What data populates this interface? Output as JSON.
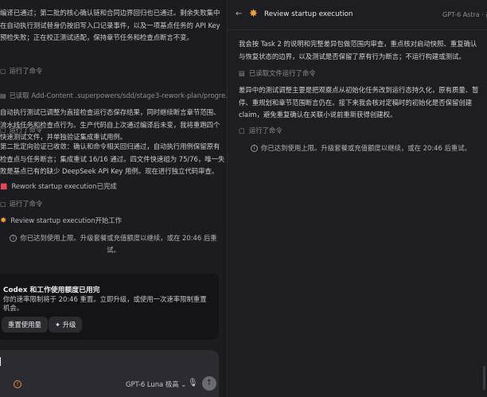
{
  "left": {
    "lines": [
      "编译已通过；第二批的核心确认链和合同边界回归也已通过。剩余失败集中",
      "在自动执行测试替身仍按旧写入口记录事件，以及一项基点任务的 API Key",
      "预检失败；正在校正测试适配，保持章节任务和检查点断言不变。"
    ],
    "meta1": "运行了命令",
    "meta2": "已读取 Add-Content .superpowers/sdd/stage3-rework-plan/progre...",
    "para2": [
      "自动执行测试已调整为直接检查运行态保存结果，同时继续断言章节范围、",
      "流水线任务和检查点行为。生产代码自上次通过编译后未变，我将重跑四个",
      "快速测试文件，并单独验证集成重试用例。"
    ],
    "meta3": "运行了命令",
    "para3": [
      "第二批定向验证已收敛：确认和命令相关回归通过，自动执行用例保留原有",
      "检查点与任务断言；集成重试 16/16 通过。四文件快速组为 75/76，唯一失",
      "败是基点已有的缺少 DeepSeek API Key 用例。现在进行独立代码审查。"
    ],
    "task_done": "Rework startup execution已完成",
    "meta4": "运行了命令",
    "task_started": "Review startup execution开始工作",
    "limit_text_1": "你已达到使用上限。升级套餐或充值额度以继续，或在 20:46 后重",
    "limit_text_2": "试。"
  },
  "card": {
    "title": "Codex 和工作使用额度已用完",
    "body_1": "你的速率限制将于 20:46 重置。立即升级，或使用一次速率限制重置",
    "body_2": "机会。",
    "reset_label": "重置使用量",
    "upgrade_label": "升级"
  },
  "composer": {
    "model_label": "GPT-6 Luna 极高"
  },
  "right": {
    "title": "Review startup execution",
    "model": "GPT-6 Astra · 高",
    "para1": [
      "我会按 Task 2 的说明和完整差异包做范围内审查，重点核对启动快照、重复确认",
      "与恢复状态的边界，以及测试是否保留了原有行为断言；不运行构建或测试。"
    ],
    "meta1": "已读取文件运行了命令",
    "para2": [
      "差异中的测试调整主要是把观察点从初始化任务改到运行态持久化，原有质量、暂",
      "停、重规划和章节范围断言仍在。接下来我会核对定稿时的初始化是否保留创建",
      "claim，避免重复确认在关联小说前重新获得创建权。"
    ],
    "meta2": "运行了命令",
    "limit_text": "你已达到使用上限。升级套餐或充值额度以继续，或在 20:46 后重试。"
  }
}
